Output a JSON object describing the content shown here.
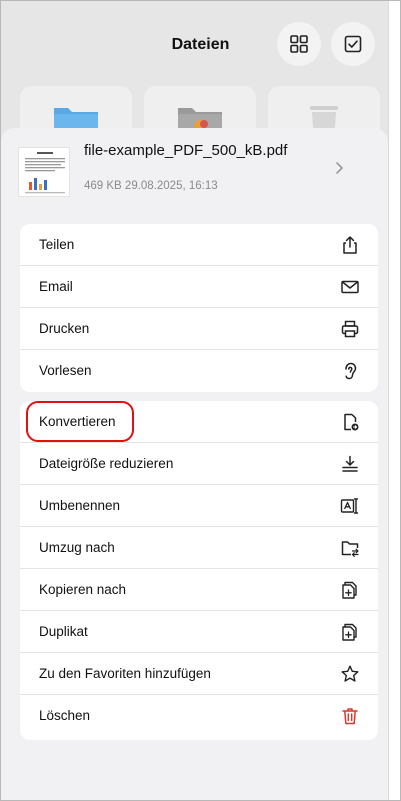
{
  "header": {
    "title": "Dateien",
    "buttons": [
      {
        "name": "grid-view-button",
        "icon": "grid-icon"
      },
      {
        "name": "select-button",
        "icon": "checkbox-icon"
      }
    ]
  },
  "file": {
    "name": "file-example_PDF_500_kB.pdf",
    "meta": "469 KB 29.08.2025, 16:13",
    "thumbnail_title": "Lorem ipsum"
  },
  "groups": [
    {
      "items": [
        {
          "label": "Teilen",
          "icon": "share-icon"
        },
        {
          "label": "Email",
          "icon": "envelope-icon"
        },
        {
          "label": "Drucken",
          "icon": "printer-icon"
        },
        {
          "label": "Vorlesen",
          "icon": "ear-icon"
        }
      ]
    },
    {
      "items": [
        {
          "label": "Konvertieren",
          "icon": "convert-document-icon",
          "highlighted": true
        },
        {
          "label": "Dateigröße reduzieren",
          "icon": "compress-icon"
        },
        {
          "label": "Umbenennen",
          "icon": "rename-icon"
        },
        {
          "label": "Umzug nach",
          "icon": "move-folder-icon"
        },
        {
          "label": "Kopieren nach",
          "icon": "copy-to-icon"
        },
        {
          "label": "Duplikat",
          "icon": "duplicate-icon"
        },
        {
          "label": "Zu den Favoriten hinzufügen",
          "icon": "star-icon"
        },
        {
          "label": "Löschen",
          "icon": "trash-icon"
        }
      ]
    }
  ],
  "colors": {
    "accent_highlight": "#e01010",
    "delete_icon": "#e0352b",
    "folder_blue": "#5aa9e6"
  }
}
